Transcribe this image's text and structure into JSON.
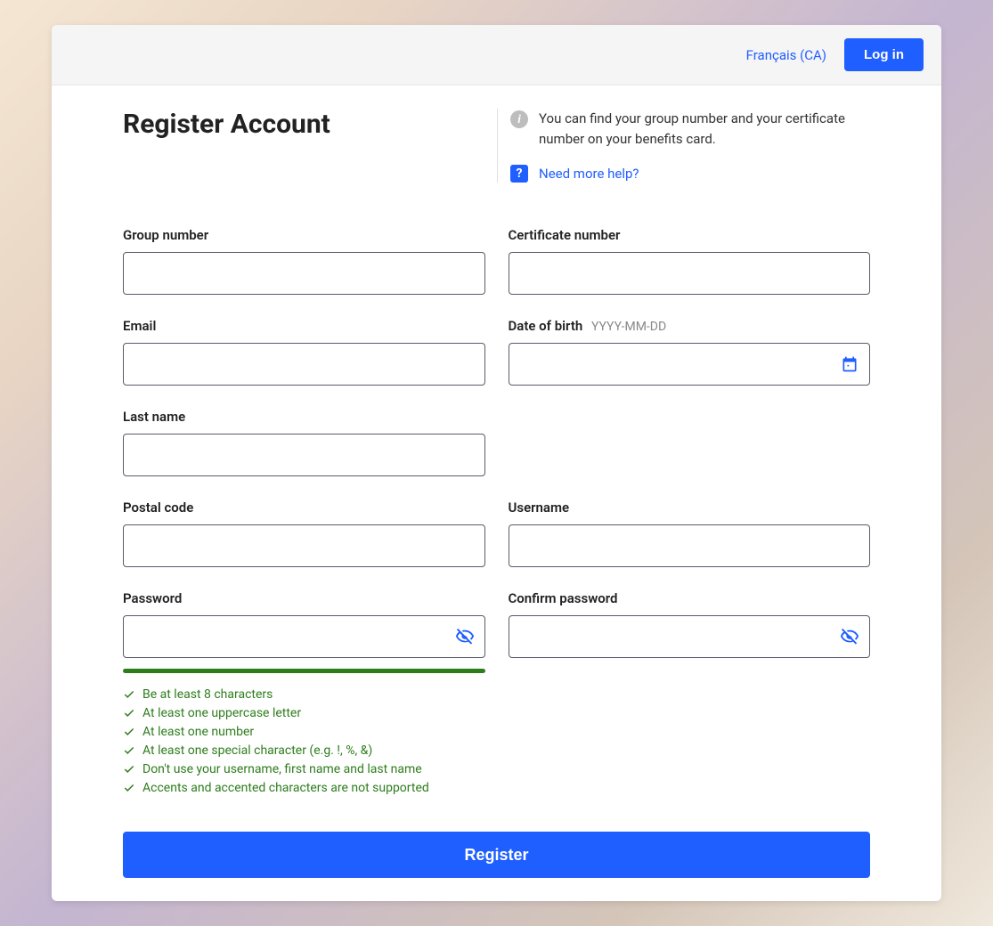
{
  "topbar": {
    "lang_label": "Français (CA)",
    "login_label": "Log in"
  },
  "header": {
    "title": "Register Account",
    "info_text": "You can find your group number and your certificate number on your benefits card.",
    "help_label": "Need more help?"
  },
  "fields": {
    "group_number": {
      "label": "Group number",
      "value": ""
    },
    "certificate_number": {
      "label": "Certificate number",
      "value": ""
    },
    "email": {
      "label": "Email",
      "value": ""
    },
    "dob": {
      "label": "Date of birth",
      "hint": "YYYY-MM-DD",
      "value": ""
    },
    "last_name": {
      "label": "Last name",
      "value": ""
    },
    "postal_code": {
      "label": "Postal code",
      "value": ""
    },
    "username": {
      "label": "Username",
      "value": ""
    },
    "password": {
      "label": "Password",
      "value": ""
    },
    "confirm_password": {
      "label": "Confirm password",
      "value": ""
    }
  },
  "rules": [
    "Be at least 8 characters",
    "At least one uppercase letter",
    "At least one number",
    "At least one special character (e.g. !, %, &)",
    "Don't use your username, first name and last name",
    "Accents and accented characters are not supported"
  ],
  "actions": {
    "register_label": "Register"
  }
}
